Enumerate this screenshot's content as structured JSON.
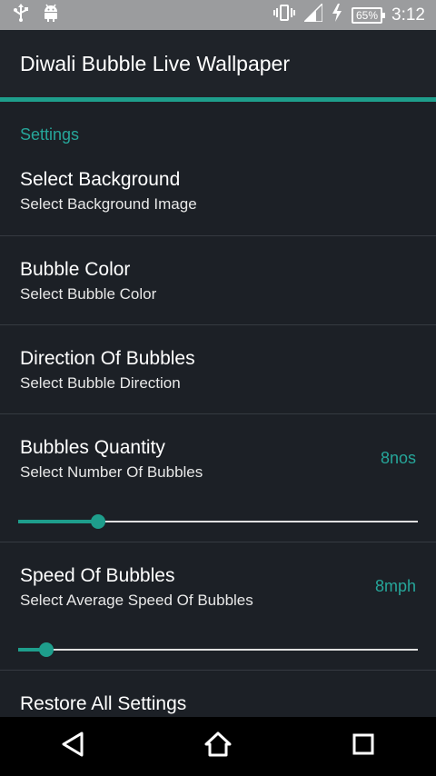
{
  "status_bar": {
    "battery_percent": "65%",
    "time": "3:12",
    "icons": [
      "usb-icon",
      "android-icon",
      "vibrate-icon",
      "signal-icon",
      "charging-icon",
      "battery-icon"
    ]
  },
  "app_bar": {
    "title": "Diwali Bubble Live Wallpaper"
  },
  "section": {
    "title": "Settings"
  },
  "preferences": [
    {
      "title": "Select Background",
      "summary": "Select Background Image"
    },
    {
      "title": "Bubble Color",
      "summary": "Select Bubble Color"
    },
    {
      "title": "Direction Of Bubbles",
      "summary": "Select Bubble Direction"
    },
    {
      "title": "Bubbles Quantity",
      "summary": "Select Number Of Bubbles",
      "value": "8nos",
      "slider_level": 0.2
    },
    {
      "title": "Speed Of Bubbles",
      "summary": "Select Average Speed Of Bubbles",
      "value": "8mph",
      "slider_level": 0.07
    },
    {
      "title": "Restore All Settings"
    }
  ],
  "colors": {
    "accent": "#1e9e8c",
    "background": "#1c2026",
    "status_bar": "#9b9c9e"
  },
  "nav_bar": {
    "icons": [
      "back-icon",
      "home-icon",
      "recents-icon"
    ]
  }
}
